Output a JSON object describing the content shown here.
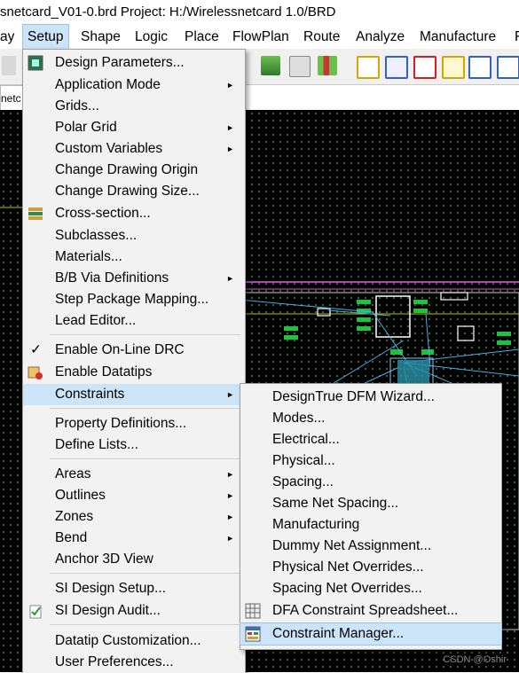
{
  "window": {
    "title": "snetcard_V01-0.brd  Project: H:/Wirelessnetcard 1.0/BRD"
  },
  "menubar": {
    "items": [
      "ay",
      "Setup",
      "Shape",
      "Logic",
      "Place",
      "FlowPlan",
      "Route",
      "Analyze",
      "Manufacture",
      "F"
    ]
  },
  "tab": {
    "label": "netc"
  },
  "setup_menu": {
    "items": [
      {
        "label": "Design Parameters...",
        "icon": "design-parameters-icon"
      },
      {
        "label": "Application Mode",
        "submenu": true
      },
      {
        "label": "Grids..."
      },
      {
        "label": "Polar Grid",
        "submenu": true
      },
      {
        "label": "Custom Variables",
        "submenu": true
      },
      {
        "label": "Change Drawing Origin"
      },
      {
        "label": "Change Drawing Size..."
      },
      {
        "label": "Cross-section...",
        "icon": "cross-section-icon"
      },
      {
        "label": "Subclasses..."
      },
      {
        "label": "Materials..."
      },
      {
        "label": "B/B Via Definitions",
        "submenu": true
      },
      {
        "label": "Step Package Mapping..."
      },
      {
        "label": "Lead Editor..."
      },
      {
        "label": "Enable On-Line DRC",
        "checked": true
      },
      {
        "label": "Enable Datatips",
        "icon": "datatips-icon"
      },
      {
        "label": "Constraints",
        "submenu": true,
        "highlighted": true
      },
      {
        "label": "Property Definitions..."
      },
      {
        "label": "Define Lists..."
      },
      {
        "label": "Areas",
        "submenu": true
      },
      {
        "label": "Outlines",
        "submenu": true
      },
      {
        "label": "Zones",
        "submenu": true
      },
      {
        "label": "Bend",
        "submenu": true
      },
      {
        "label": "Anchor 3D View"
      },
      {
        "label": "SI Design Setup..."
      },
      {
        "label": "SI Design Audit...",
        "icon": "si-audit-icon"
      },
      {
        "label": "Datatip Customization..."
      },
      {
        "label": "User Preferences..."
      }
    ]
  },
  "constraints_menu": {
    "items": [
      {
        "label": "DesignTrue DFM Wizard..."
      },
      {
        "label": "Modes..."
      },
      {
        "label": "Electrical..."
      },
      {
        "label": "Physical..."
      },
      {
        "label": "Spacing..."
      },
      {
        "label": "Same Net Spacing..."
      },
      {
        "label": "Manufacturing"
      },
      {
        "label": "Dummy Net Assignment..."
      },
      {
        "label": "Physical Net Overrides..."
      },
      {
        "label": "Spacing Net Overrides..."
      },
      {
        "label": "DFA Constraint Spreadsheet...",
        "icon": "dfa-spreadsheet-icon"
      },
      {
        "label": "Constraint Manager...",
        "icon": "constraint-manager-icon",
        "highlighted": true
      }
    ]
  },
  "icons": {
    "checkmark": "✓",
    "submenu_arrow": "►"
  },
  "watermark": "CSDN @Oshir",
  "colors": {
    "highlight": "#cce4f7",
    "menu_bg": "#f2f2f2",
    "canvas_bg": "#000000",
    "grid": "#4a8c4a"
  }
}
